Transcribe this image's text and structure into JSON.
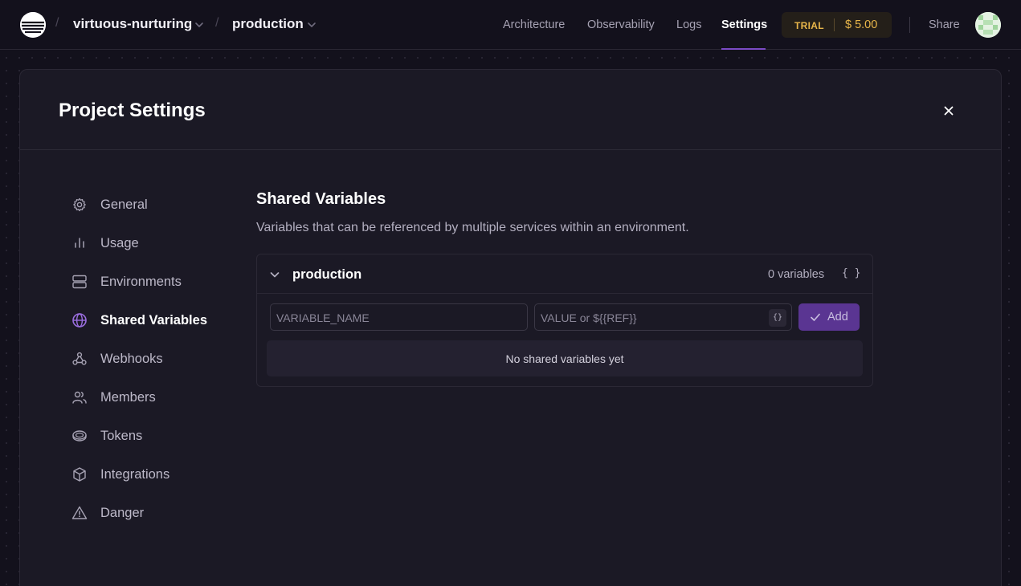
{
  "header": {
    "project_name": "virtuous-nurturing",
    "environment_name": "production",
    "nav": [
      "Architecture",
      "Observability",
      "Logs",
      "Settings"
    ],
    "active_nav": "Settings",
    "trial_label": "TRIAL",
    "trial_amount": "$ 5.00",
    "share_label": "Share"
  },
  "modal": {
    "title": "Project Settings",
    "sidebar": [
      {
        "label": "General",
        "icon": "gear-icon"
      },
      {
        "label": "Usage",
        "icon": "bar-chart-icon"
      },
      {
        "label": "Environments",
        "icon": "server-stack-icon"
      },
      {
        "label": "Shared Variables",
        "icon": "globe-icon",
        "active": true
      },
      {
        "label": "Webhooks",
        "icon": "webhook-icon"
      },
      {
        "label": "Members",
        "icon": "users-icon"
      },
      {
        "label": "Tokens",
        "icon": "token-icon"
      },
      {
        "label": "Integrations",
        "icon": "box-icon"
      },
      {
        "label": "Danger",
        "icon": "warning-icon"
      }
    ]
  },
  "shared_variables": {
    "title": "Shared Variables",
    "description": "Variables that can be referenced by multiple services within an environment.",
    "environment": "production",
    "count_label": "0 variables",
    "braces_label": "{ }",
    "name_placeholder": "VARIABLE_NAME",
    "value_placeholder": "VALUE or ${{REF}}",
    "value_brace": "{}",
    "add_label": "Add",
    "empty_text": "No shared variables yet"
  },
  "colors": {
    "accent": "#7b4bc6",
    "add_button": "#5a3592",
    "trial": "#e8b64a",
    "background": "#13111c",
    "modal": "#1b1925"
  }
}
